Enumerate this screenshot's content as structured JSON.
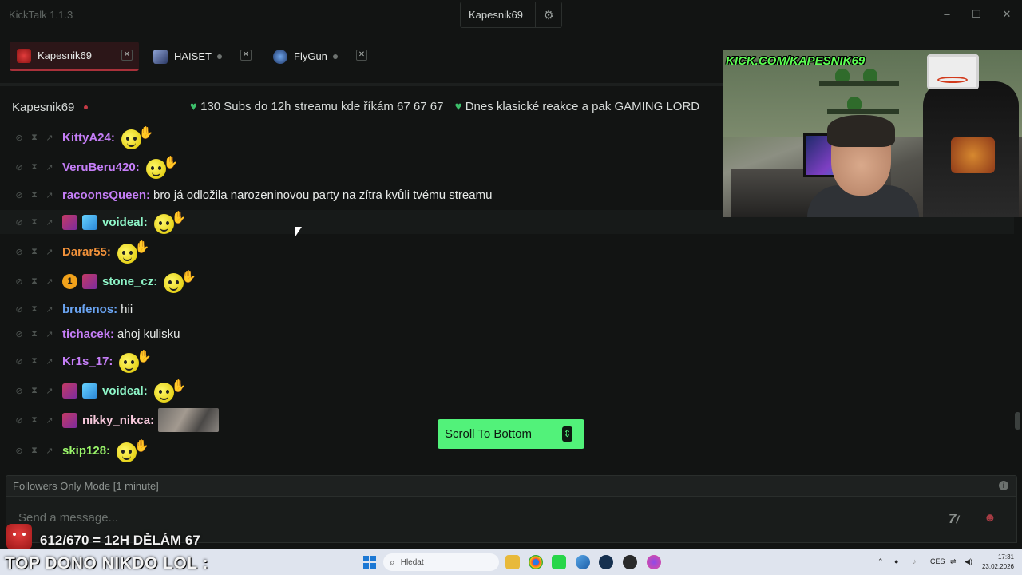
{
  "app": {
    "title": "KickTalk 1.1.3",
    "current_user": "Kapesnik69"
  },
  "tabs": [
    {
      "name": "Kapesnik69",
      "active": true,
      "live": true,
      "color": "#c43a45"
    },
    {
      "name": "HAISET",
      "active": false,
      "live": false
    },
    {
      "name": "FlyGun",
      "active": false,
      "live": false
    }
  ],
  "chat_header": {
    "streamer": "Kapesnik69",
    "ticker": "130 Subs do 12h streamu kde říkám 67 67 67",
    "ticker2": "Dnes klasické reakce a pak GAMING LORD"
  },
  "messages": [
    {
      "user": "KittyA24",
      "color": "#c57ef7",
      "text": "",
      "emote": "smiley-wave",
      "badges": []
    },
    {
      "user": "VeruBeru420",
      "color": "#c57ef7",
      "text": "",
      "emote": "smiley-wave",
      "badges": []
    },
    {
      "user": "racoonsQueen",
      "color": "#c57ef7",
      "text": "bro já odložila narozeninovou party na zítra kvůli tvému streamu",
      "emote": "",
      "badges": []
    },
    {
      "user": "voideal",
      "color": "#8ff7c9",
      "text": "",
      "emote": "smiley-wave",
      "badges": [
        "subscriber",
        "cube"
      ]
    },
    {
      "user": "Darar55",
      "color": "#f0913a",
      "text": "",
      "emote": "smiley-wave",
      "badges": []
    },
    {
      "user": "stone_cz",
      "color": "#8ff7c9",
      "text": "",
      "emote": "smiley-wave",
      "badges": [
        "gift-1",
        "subscriber"
      ]
    },
    {
      "user": "brufenos",
      "color": "#6aa4f2",
      "text": "hii",
      "emote": "",
      "badges": []
    },
    {
      "user": "tichacek",
      "color": "#c57ef7",
      "text": "ahoj kulisku",
      "emote": "",
      "badges": []
    },
    {
      "user": "Kr1s_17",
      "color": "#c57ef7",
      "text": "",
      "emote": "smiley-wave",
      "badges": []
    },
    {
      "user": "voideal",
      "color": "#8ff7c9",
      "text": "",
      "emote": "smiley-wave",
      "badges": [
        "subscriber",
        "cube"
      ]
    },
    {
      "user": "nikky_nikca",
      "color": "#f7c9dc",
      "text": "",
      "emote": "image",
      "badges": [
        "subscriber"
      ]
    },
    {
      "user": "skip128",
      "color": "#9af56a",
      "text": "",
      "emote": "smiley-wave",
      "badges": []
    }
  ],
  "badge_gift_label": "1",
  "scroll_button": {
    "label": "Scroll To Bottom"
  },
  "chat_mode": "Followers Only Mode [1 minute]",
  "input": {
    "placeholder": "Send a message...",
    "seventv_label": "7tv"
  },
  "overlay": {
    "banner": "KICK.COM/KAPESNIK69",
    "goal": "612/670 = 12H DĚLÁM 67",
    "top_dono": "TOP DONO NIKDO LOL :"
  },
  "taskbar": {
    "search_placeholder": "Hledat",
    "language": "CES",
    "time": "17:31",
    "date": "23.02.2026"
  },
  "colors": {
    "accent": "#52f27a",
    "live": "#c43a45",
    "heart": "#3cbf6a"
  }
}
